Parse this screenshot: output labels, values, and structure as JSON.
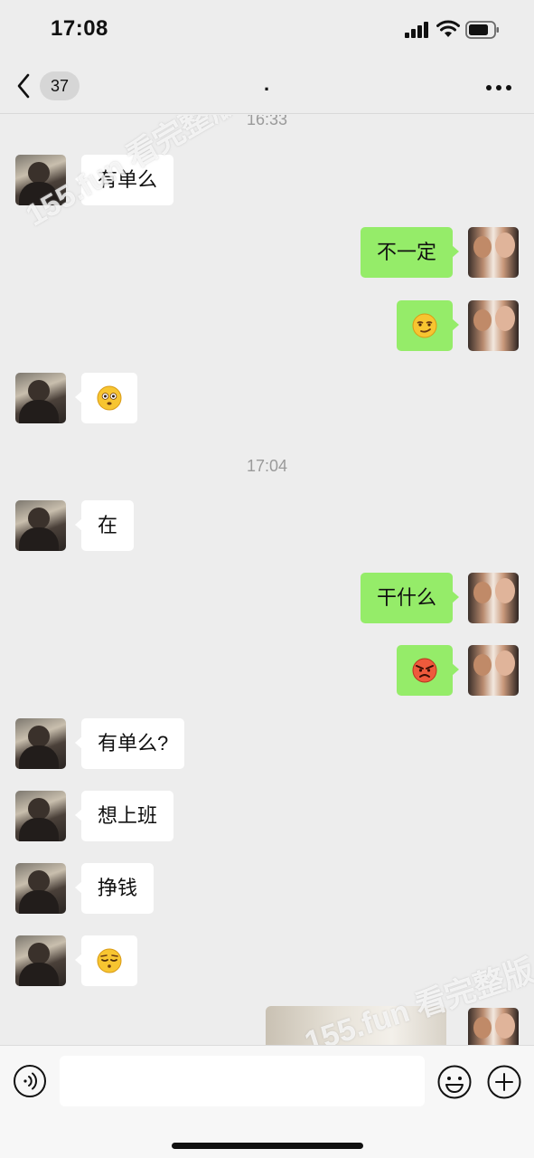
{
  "status_bar": {
    "time": "17:08"
  },
  "header": {
    "unread_count": "37",
    "title": "."
  },
  "messages": [
    {
      "type": "timestamp",
      "text": "16:33"
    },
    {
      "type": "text",
      "side": "in",
      "text": "有单么"
    },
    {
      "type": "text",
      "side": "out",
      "text": "不一定"
    },
    {
      "type": "emoji",
      "side": "out",
      "icon": "smirk-emoji-icon"
    },
    {
      "type": "emoji",
      "side": "in",
      "icon": "flushed-emoji-icon"
    },
    {
      "type": "timestamp",
      "text": "17:04"
    },
    {
      "type": "text",
      "side": "in",
      "text": "在"
    },
    {
      "type": "text",
      "side": "out",
      "text": "干什么"
    },
    {
      "type": "emoji",
      "side": "out",
      "icon": "angry-emoji-icon"
    },
    {
      "type": "text",
      "side": "in",
      "text": "有单么?"
    },
    {
      "type": "text",
      "side": "in",
      "text": "想上班"
    },
    {
      "type": "text",
      "side": "in",
      "text": "挣钱"
    },
    {
      "type": "emoji",
      "side": "in",
      "icon": "relieved-emoji-icon"
    },
    {
      "type": "image",
      "side": "out"
    }
  ],
  "watermarks": [
    "155.fun 看完整版",
    "155.fun 看完整版"
  ],
  "input_bar": {
    "placeholder": ""
  },
  "colors": {
    "background": "#ededed",
    "outgoing_bubble": "#95ec69",
    "incoming_bubble": "#ffffff",
    "timestamp": "#9a9a9a"
  }
}
